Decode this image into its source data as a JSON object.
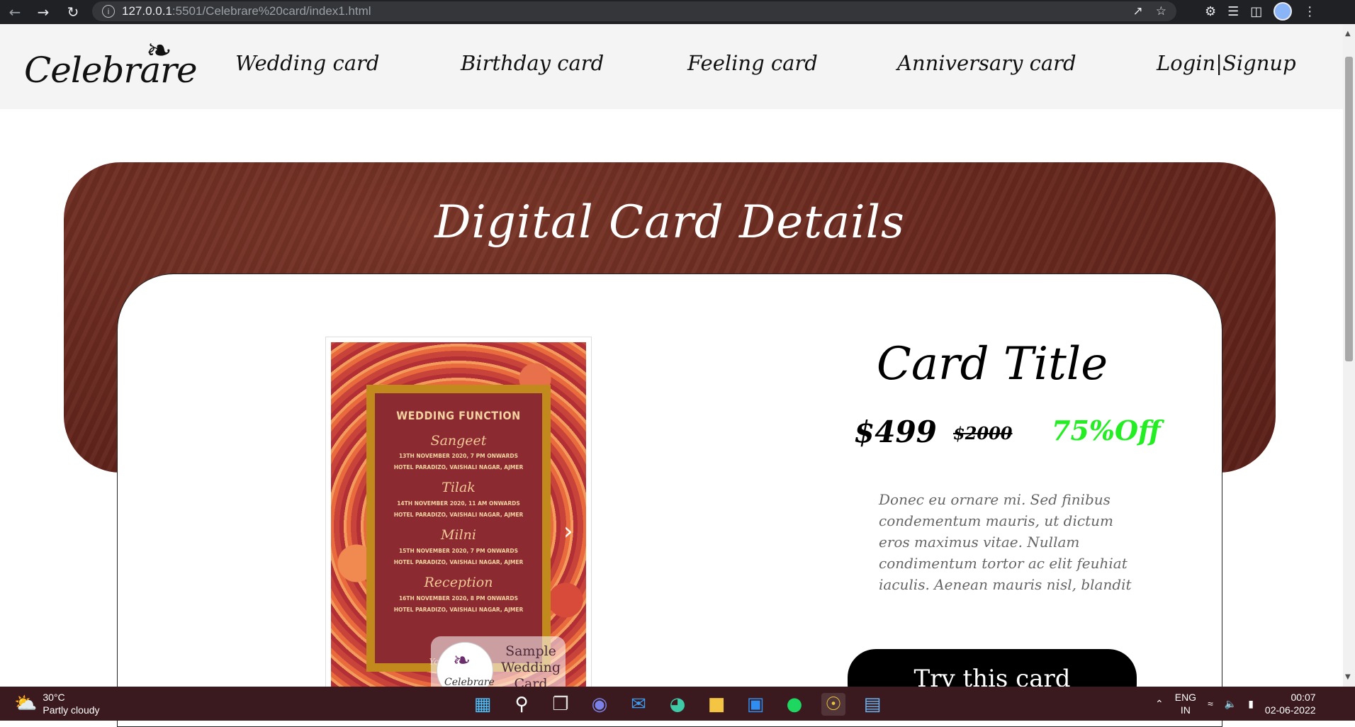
{
  "browser": {
    "url_host": "127.0.0.1",
    "url_rest": ":5501/Celebrare%20card/index1.html"
  },
  "site": {
    "logo": "Celebrare",
    "nav": [
      "Wedding card",
      "Birthday card",
      "Feeling card",
      "Anniversary card",
      "Login|Signup"
    ]
  },
  "hero": {
    "title": "Digital Card Details"
  },
  "card_image": {
    "heading": "WEDDING FUNCTION",
    "events": [
      {
        "name": "Sangeet",
        "date": "13TH NOVEMBER 2020, 7 PM ONWARDS",
        "venue": "HOTEL PARADIZO, VAISHALI NAGAR, AJMER"
      },
      {
        "name": "Tilak",
        "date": "14TH NOVEMBER 2020, 11 AM ONWARDS",
        "venue": "HOTEL PARADIZO, VAISHALI NAGAR, AJMER"
      },
      {
        "name": "Milni",
        "date": "15TH NOVEMBER 2020, 7 PM ONWARDS",
        "venue": "HOTEL PARADIZO, VAISHALI NAGAR, AJMER"
      },
      {
        "name": "Reception",
        "date": "16TH NOVEMBER 2020, 8 PM ONWARDS",
        "venue": "HOTEL PARADIZO, VAISHALI NAGAR, AJMER"
      }
    ],
    "footer": "Your P... ...ed!",
    "watermark_logo": "Celebrare",
    "watermark_text": "Sample Wedding Card"
  },
  "details": {
    "title": "Card Title",
    "price": "$499",
    "old_price": "$2000",
    "discount": "75%Off",
    "description": "Donec eu ornare mi. Sed finibus condementum mauris, ut dictum eros maximus vitae. Nullam condimentum tortor ac elit feuhiat iaculis. Aenean mauris nisl, blandit",
    "button": "Try this card"
  },
  "taskbar": {
    "temperature": "30°C",
    "weather": "Partly cloudy",
    "lang_top": "ENG",
    "lang_bottom": "IN",
    "time": "00:07",
    "date": "02-06-2022"
  },
  "colors": {
    "discount": "#22ee22",
    "hero_bg": "#6a2a20",
    "taskbar": "#3a1a1e"
  }
}
